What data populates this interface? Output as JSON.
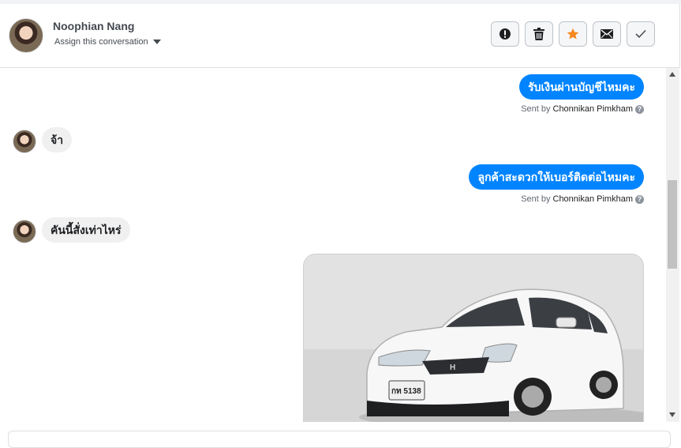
{
  "header": {
    "contact_name": "Noophian Nang",
    "assign_label": "Assign this conversation",
    "buttons": [
      {
        "name": "alert",
        "icon": "exclamation-circle-icon"
      },
      {
        "name": "delete",
        "icon": "trash-icon"
      },
      {
        "name": "star",
        "icon": "star-icon",
        "color": "#f5881f"
      },
      {
        "name": "email",
        "icon": "envelope-icon"
      },
      {
        "name": "done",
        "icon": "checkmark-icon"
      }
    ]
  },
  "messages": {
    "m1": {
      "text": "รับเงินผ่านบัญชีไหมคะ",
      "sent_prefix": "Sent by",
      "sender": "Chonnikan Pimkham"
    },
    "m2": {
      "text": "จ้า"
    },
    "m3": {
      "text": "ลูกค้าสะดวกให้เบอร์ติดต่อไหมคะ",
      "sent_prefix": "Sent by",
      "sender": "Chonnikan Pimkham"
    },
    "m4": {
      "text": "คันนี้สั่งเท่าไหร่"
    },
    "m5": {
      "photo_plate": "กท 5138"
    }
  },
  "colors": {
    "outgoing_bubble": "#0084ff",
    "incoming_bubble": "#f0f0f0",
    "accent_star": "#f5881f"
  }
}
